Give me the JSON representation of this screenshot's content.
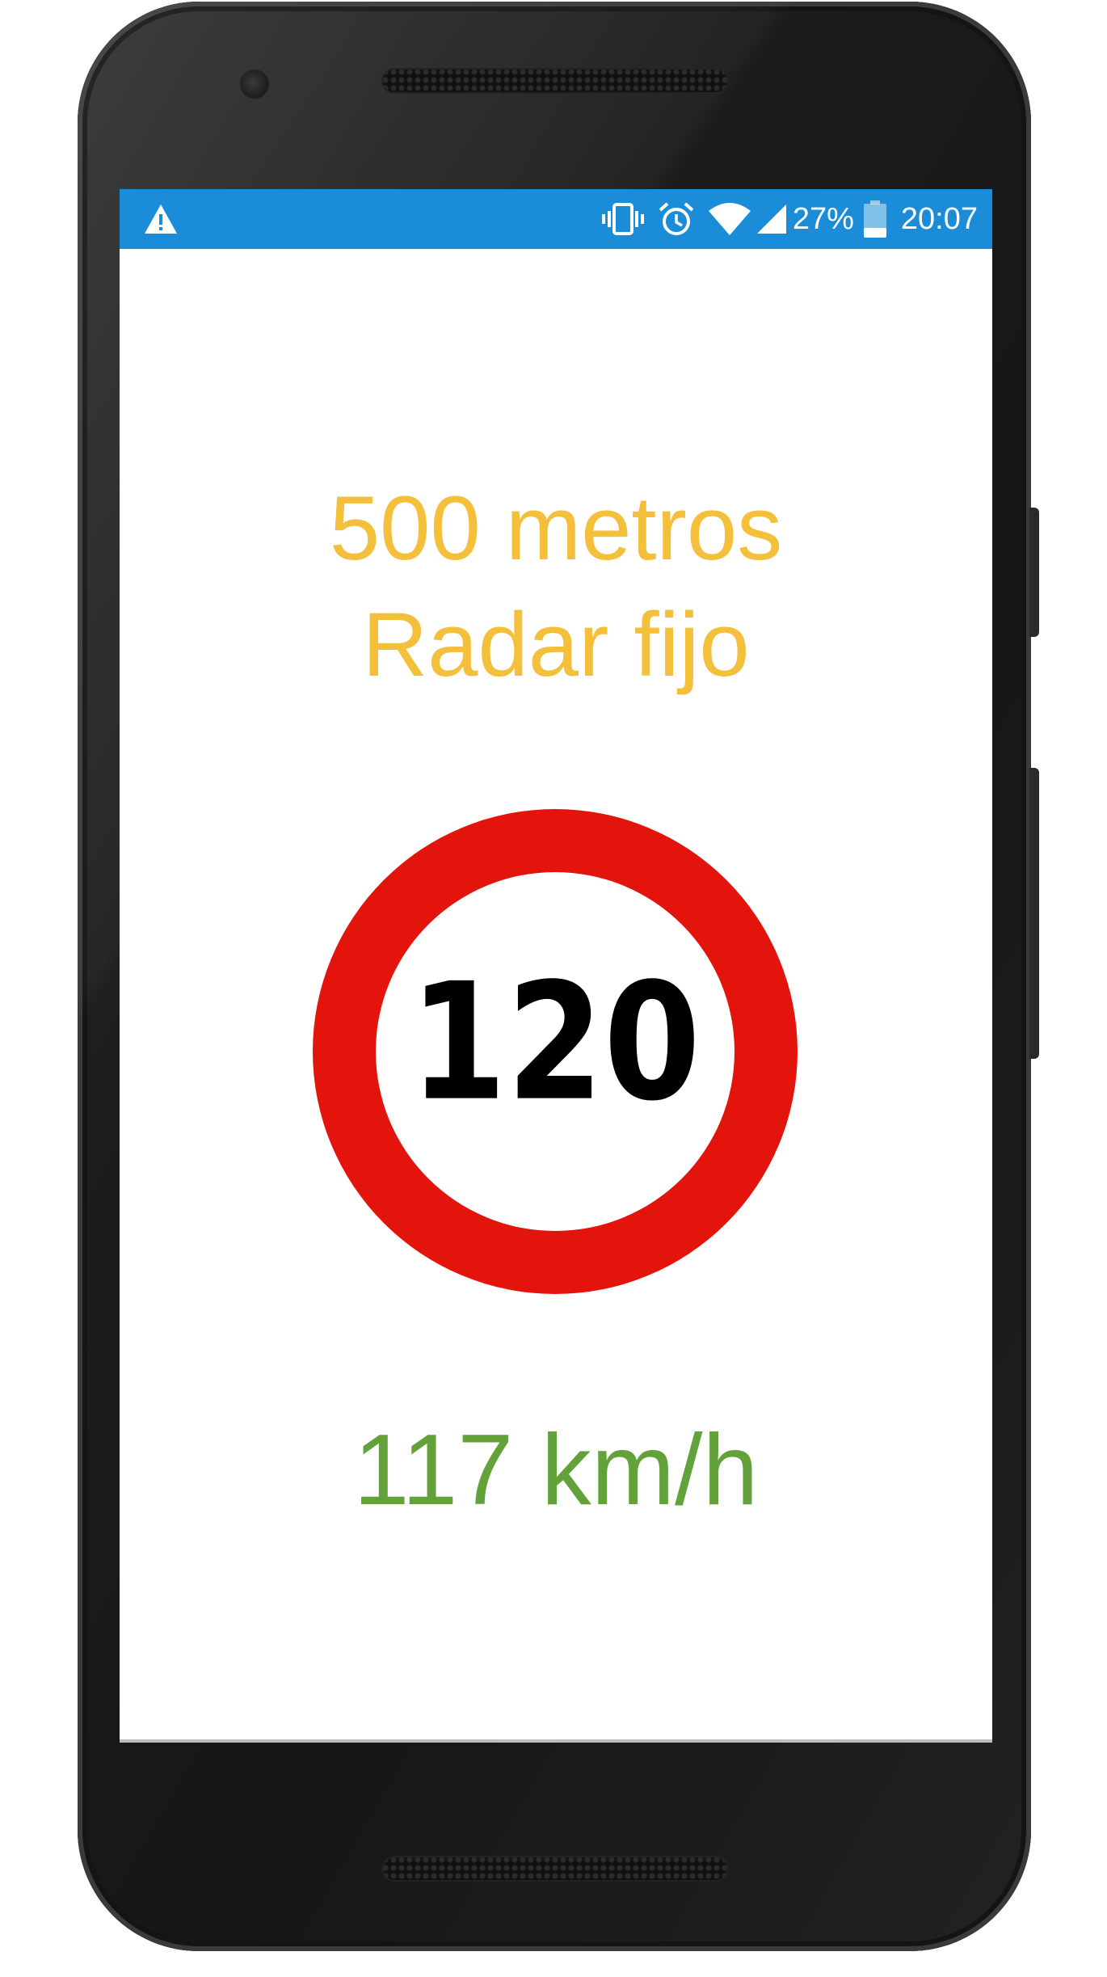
{
  "status_bar": {
    "warning_icon": "warning-triangle-icon",
    "icons": [
      "vibrate-icon",
      "alarm-icon",
      "wifi-icon",
      "cell-signal-icon",
      "battery-icon"
    ],
    "battery_percent": "27%",
    "time": "20:07",
    "background_color": "#1a8cd8"
  },
  "alert": {
    "distance": "500 metros",
    "type": "Radar fijo",
    "text_color": "#f4bf3a"
  },
  "speed_limit_sign": {
    "value": "120",
    "ring_color": "#e3140c",
    "inner_color": "#ffffff",
    "text_color": "#000000"
  },
  "current_speed": {
    "value": "117 km/h",
    "text_color": "#63a23b"
  }
}
